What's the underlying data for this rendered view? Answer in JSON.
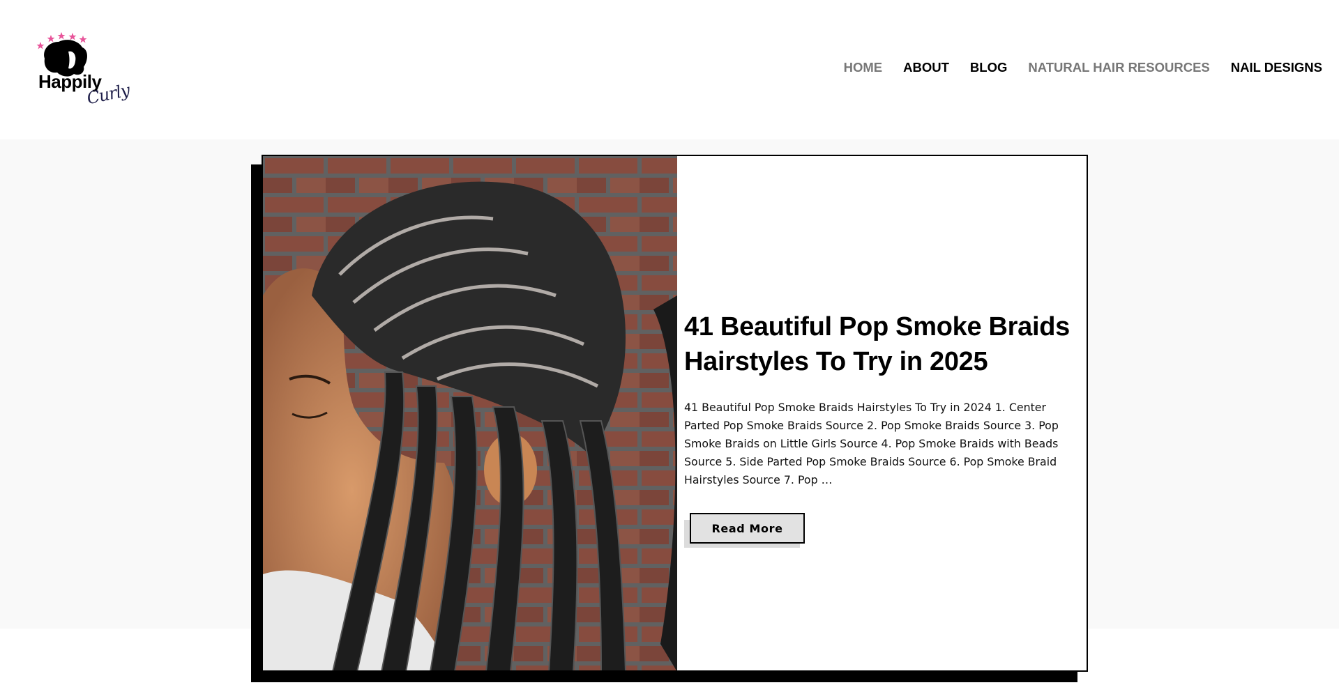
{
  "site": {
    "logo_word": "Happily",
    "logo_script": "Curly"
  },
  "nav": {
    "items": [
      {
        "label": "HOME",
        "active": false
      },
      {
        "label": "ABOUT",
        "active": true
      },
      {
        "label": "BLOG",
        "active": true
      },
      {
        "label": "NATURAL HAIR RESOURCES",
        "active": false
      },
      {
        "label": "NAIL DESIGNS",
        "active": true
      }
    ]
  },
  "featured_post": {
    "title": "41 Beautiful Pop Smoke Braids Hairstyles To Try in 2025",
    "excerpt": "41 Beautiful Pop Smoke Braids Hairstyles To Try in 2024 1. Center Parted Pop Smoke Braids Source 2. Pop Smoke Braids Source   3. Pop Smoke Braids on Little Girls Source 4. Pop Smoke Braids with Beads Source   5. Side Parted Pop Smoke Braids Source 6. Pop Smoke Braid Hairstyles Source   7. Pop …",
    "read_more_label": "Read More",
    "image_icon": "braids-photo"
  },
  "colors": {
    "nav_active": "#000000",
    "nav_muted": "#777777",
    "band_bg": "#f9f9f9",
    "button_bg": "#e2e2e2",
    "logo_stars": "#e8559a"
  }
}
